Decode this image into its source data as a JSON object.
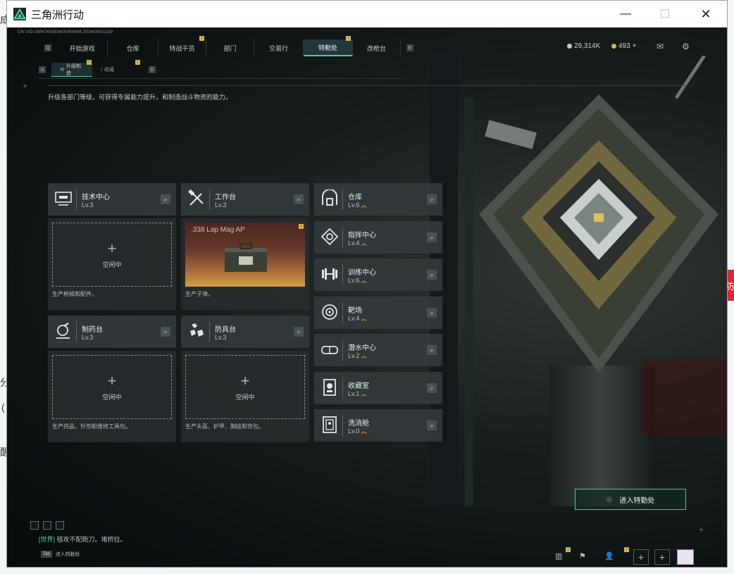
{
  "window": {
    "title": "三角洲行动",
    "controls": {
      "minimize": "—",
      "maximize": "☐",
      "close": "✕"
    }
  },
  "header": {
    "uid": "CN UID:1684765583609459566,202608031339",
    "nav": [
      {
        "label": "开始游戏",
        "badge": ""
      },
      {
        "label": "仓库",
        "badge": ""
      },
      {
        "label": "特战干员",
        "badge": "!"
      },
      {
        "label": "部门",
        "badge": ""
      },
      {
        "label": "交易行",
        "badge": ""
      },
      {
        "label": "特勤处",
        "badge": "!",
        "active": true
      },
      {
        "label": "改枪台",
        "badge": ""
      }
    ],
    "currency1": "29,314K",
    "currency2": "493",
    "currency2_plus": "+",
    "sub_nav": [
      {
        "label": "升级制造",
        "active": true
      },
      {
        "label": "收藏",
        "active": false
      }
    ]
  },
  "description": "升级各部门等级，可获得专属能力提升，和制造战斗物资的能力。",
  "stations": [
    {
      "name": "技术中心",
      "level": "Lv.3",
      "icon": "computer-icon",
      "status": "空闲中",
      "desc": "生产枪械和配件。"
    },
    {
      "name": "工作台",
      "level": "Lv.3",
      "icon": "tools-icon",
      "product": ".338 Lap Mag AP",
      "desc": "生产子弹。"
    },
    {
      "name": "制药台",
      "level": "Lv.3",
      "icon": "microscope-icon",
      "status": "空闲中",
      "desc": "生产药品、针剂和维修工具包。"
    },
    {
      "name": "防具台",
      "level": "Lv.3",
      "icon": "armor-icon",
      "status": "空闲中",
      "desc": "生产头盔、护甲、胸挂和背包。"
    }
  ],
  "facilities": [
    {
      "name": "仓库",
      "level": "Lv.6",
      "icon": "warehouse-icon"
    },
    {
      "name": "指挥中心",
      "level": "Lv.4",
      "icon": "command-icon"
    },
    {
      "name": "训练中心",
      "level": "Lv.6",
      "icon": "dumbbell-icon"
    },
    {
      "name": "靶场",
      "level": "Lv.4",
      "icon": "target-icon"
    },
    {
      "name": "潜水中心",
      "level": "Lv.2",
      "icon": "goggles-icon"
    },
    {
      "name": "收藏室",
      "level": "Lv.1",
      "icon": "collection-icon"
    },
    {
      "name": "洗消舱",
      "level": "Lv.0",
      "icon": "decontam-icon"
    }
  ],
  "enter_button": "进入特勤处",
  "chat": {
    "channel": "[世界]",
    "text": "毯攻不配跑刀。堵桥拉。"
  },
  "tab_hint": {
    "key": "Tab",
    "label": "进入特勤处"
  },
  "background": {
    "frag_left_1": "成",
    "frag_left_2": "分",
    "frag_left_3": "(",
    "frag_left_4": "醒",
    "red_tab": "防"
  }
}
